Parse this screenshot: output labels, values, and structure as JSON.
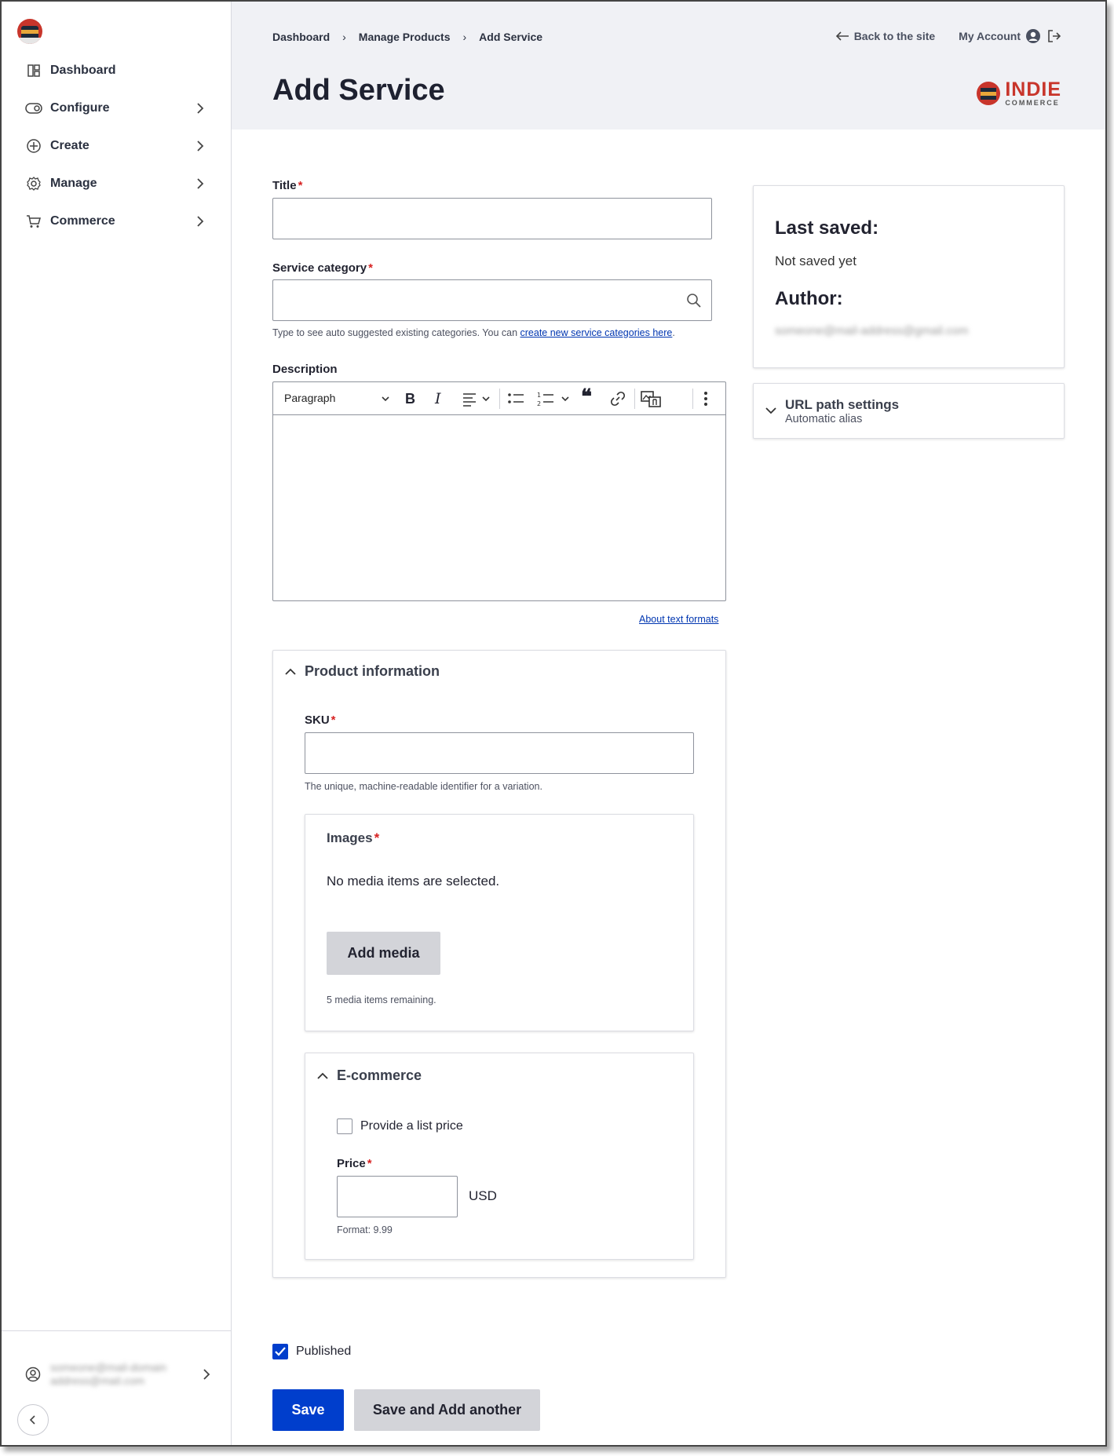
{
  "sidebar": {
    "items": [
      {
        "label": "Dashboard",
        "icon": "dashboard-icon"
      },
      {
        "label": "Configure",
        "icon": "toggle-icon"
      },
      {
        "label": "Create",
        "icon": "plus-circle-icon"
      },
      {
        "label": "Manage",
        "icon": "gear-icon"
      },
      {
        "label": "Commerce",
        "icon": "cart-icon"
      }
    ],
    "user_line1": "someone@mail-domain",
    "user_line2": "address@mail.com"
  },
  "header": {
    "breadcrumb": [
      "Dashboard",
      "Manage Products",
      "Add Service"
    ],
    "title": "Add Service",
    "back_link": "Back to the site",
    "account_link": "My Account",
    "brand_top": "INDIE",
    "brand_bottom": "COMMERCE"
  },
  "form": {
    "title_label": "Title",
    "category_label": "Service category",
    "category_help": "Type to see auto suggested existing categories. You can ",
    "category_help_link": "create new service categories here",
    "category_help_end": ".",
    "description_label": "Description",
    "toolbar_format": "Paragraph",
    "text_formats_link": "About text formats",
    "product_info": {
      "heading": "Product information",
      "sku_label": "SKU",
      "sku_help": "The unique, machine-readable identifier for a variation.",
      "images_label": "Images",
      "images_empty": "No media items are selected.",
      "add_media": "Add media",
      "media_remaining": "5 media items remaining."
    },
    "ecommerce": {
      "heading": "E-commerce",
      "list_price_label": "Provide a list price",
      "price_label": "Price",
      "currency": "USD",
      "price_format": "Format: 9.99"
    },
    "published_label": "Published",
    "published": true,
    "save": "Save",
    "save_add_another": "Save and Add another"
  },
  "meta": {
    "last_saved_label": "Last saved:",
    "last_saved_value": "Not saved yet",
    "author_label": "Author:",
    "author_value": "someone@mail-address@gmail.com",
    "url_heading": "URL path settings",
    "url_sub": "Automatic alias"
  }
}
